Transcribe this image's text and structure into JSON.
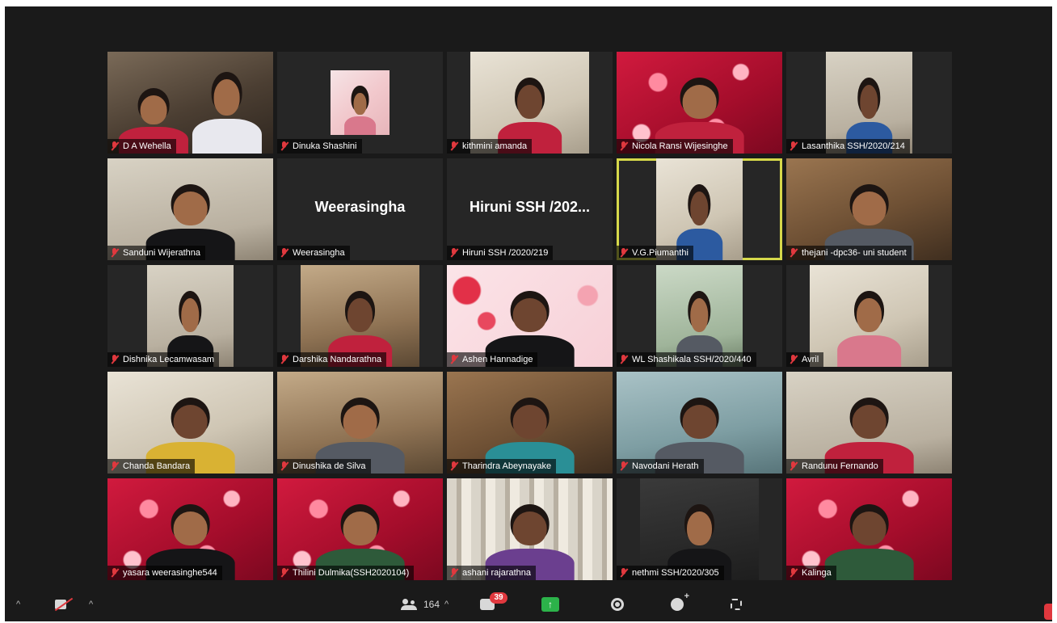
{
  "participants": [
    {
      "name": "D A Wehella",
      "display": "",
      "bg": "bg-room",
      "video": "full",
      "people": [
        [
          "c-red",
          "light"
        ],
        [
          "c-white",
          "light"
        ]
      ]
    },
    {
      "name": "Dinuka Shashini",
      "display": "",
      "bg": "bg-pink",
      "video": "small",
      "people": [
        [
          "c-pink",
          "light"
        ]
      ]
    },
    {
      "name": "kithmini amanda",
      "display": "",
      "bg": "bg-light",
      "video": "mid",
      "people": [
        [
          "c-red",
          "dark"
        ]
      ]
    },
    {
      "name": "Nicola Ransi Wijesinghe",
      "display": "",
      "bg": "bg-red",
      "video": "full",
      "people": [
        [
          "c-red",
          "light"
        ]
      ]
    },
    {
      "name": "Lasanthika SSH/2020/214",
      "display": "",
      "bg": "bg-wall",
      "video": "narrow",
      "people": [
        [
          "c-blue",
          "dark"
        ]
      ]
    },
    {
      "name": "Sanduni Wijerathna",
      "display": "",
      "bg": "bg-wall",
      "video": "full",
      "people": [
        [
          "c-black",
          "light"
        ]
      ]
    },
    {
      "name": "Weerasingha",
      "display": "Weerasingha",
      "bg": "",
      "video": "",
      "people": []
    },
    {
      "name": "Hiruni SSH /2020/219",
      "display": "Hiruni SSH /202...",
      "bg": "",
      "video": "",
      "people": []
    },
    {
      "name": "V.G.Piumanthi",
      "display": "",
      "bg": "bg-light",
      "video": "narrow",
      "people": [
        [
          "c-blue",
          "dark"
        ]
      ],
      "active": true
    },
    {
      "name": "thejani -dpc36- uni student",
      "display": "",
      "bg": "bg-wood",
      "video": "full",
      "people": [
        [
          "c-gray",
          "light"
        ]
      ]
    },
    {
      "name": "Dishnika Lecamwasam",
      "display": "",
      "bg": "bg-wall",
      "video": "narrow",
      "people": [
        [
          "c-black",
          "light"
        ]
      ]
    },
    {
      "name": "Darshika Nandarathna",
      "display": "",
      "bg": "bg-book",
      "video": "mid",
      "people": [
        [
          "c-red",
          "dark"
        ]
      ]
    },
    {
      "name": "Ashen Hannadige",
      "display": "",
      "bg": "bg-hearts",
      "video": "full",
      "people": [
        [
          "c-black",
          "dark"
        ]
      ]
    },
    {
      "name": "WL Shashikala SSH/2020/440",
      "display": "",
      "bg": "bg-green",
      "video": "narrow",
      "people": [
        [
          "c-gray",
          "light"
        ]
      ]
    },
    {
      "name": "Avril",
      "display": "",
      "bg": "bg-light",
      "video": "mid",
      "people": [
        [
          "c-pink",
          "light"
        ]
      ]
    },
    {
      "name": "Chanda Bandara",
      "display": "",
      "bg": "bg-light",
      "video": "full",
      "people": [
        [
          "c-yellow",
          "dark"
        ]
      ]
    },
    {
      "name": "Dinushika de Silva",
      "display": "",
      "bg": "bg-book",
      "video": "full",
      "people": [
        [
          "c-gray",
          "light"
        ]
      ]
    },
    {
      "name": "Tharindra Abeynayake",
      "display": "",
      "bg": "bg-wood",
      "video": "full",
      "people": [
        [
          "c-teal",
          "dark"
        ]
      ]
    },
    {
      "name": "Navodani Herath",
      "display": "",
      "bg": "bg-teal",
      "video": "full",
      "people": [
        [
          "c-gray",
          "dark"
        ]
      ]
    },
    {
      "name": "Randunu Fernando",
      "display": "",
      "bg": "bg-wall",
      "video": "full",
      "people": [
        [
          "c-red",
          "dark"
        ]
      ]
    },
    {
      "name": "yasara weerasinghe544",
      "display": "",
      "bg": "bg-red",
      "video": "full",
      "people": [
        [
          "c-black",
          "light"
        ]
      ]
    },
    {
      "name": "Thilini Dulmika(SSH2020104)",
      "display": "",
      "bg": "bg-red",
      "video": "full",
      "people": [
        [
          "c-green",
          "light"
        ]
      ]
    },
    {
      "name": "ashani rajarathna",
      "display": "",
      "bg": "bg-curtain",
      "video": "full",
      "people": [
        [
          "c-purple",
          "dark"
        ]
      ]
    },
    {
      "name": "nethmi SSH/2020/305",
      "display": "",
      "bg": "bg-dark",
      "video": "mid",
      "people": [
        [
          "c-black",
          "light"
        ]
      ]
    },
    {
      "name": "Kalinga",
      "display": "",
      "bg": "bg-red",
      "video": "full",
      "people": [
        [
          "c-green",
          "dark"
        ]
      ]
    }
  ],
  "toolbar": {
    "participant_count": "164",
    "chat_badge": "39",
    "share_glyph": "↑",
    "caret_glyph": "^"
  },
  "colors": {
    "active_speaker_border": "#d6d84a",
    "muted_mic": "#e0383e",
    "share_button": "#2cb34a",
    "window_bg": "#1a1a1a"
  },
  "icons": [
    "microphone-muted-icon",
    "video-off-icon",
    "participants-icon",
    "chat-icon",
    "share-screen-icon",
    "record-icon",
    "reactions-icon",
    "apps-icon"
  ]
}
